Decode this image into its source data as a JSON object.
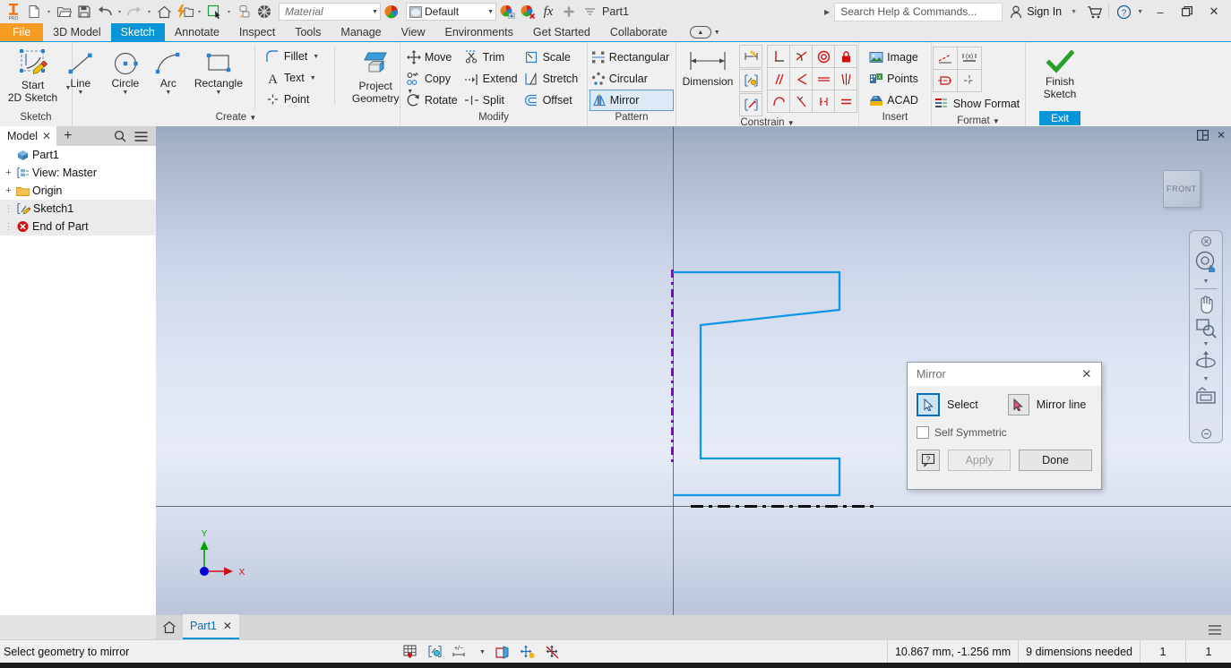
{
  "window": {
    "document_title": "Part1",
    "minimize": "–",
    "restore": "❐",
    "close": "✕"
  },
  "quick_access": {
    "logo": "inventor-pro-logo",
    "items": [
      {
        "name": "new-document",
        "icon": "new-file-icon",
        "has_dropdown": true
      },
      {
        "name": "open-document",
        "icon": "open-folder-icon",
        "has_dropdown": false
      },
      {
        "name": "save-document",
        "icon": "save-disk-icon",
        "has_dropdown": false
      },
      {
        "name": "undo",
        "icon": "undo-arrow-icon",
        "has_dropdown": true
      },
      {
        "name": "redo",
        "icon": "redo-arrow-icon",
        "has_dropdown": true
      },
      {
        "name": "home",
        "icon": "home-icon",
        "has_dropdown": false
      },
      {
        "name": "update",
        "icon": "lightning-update-icon",
        "has_dropdown": true
      },
      {
        "name": "select",
        "icon": "select-cursor-icon",
        "has_dropdown": true
      },
      {
        "name": "return",
        "icon": "return-icon",
        "has_dropdown": false
      },
      {
        "name": "appearance-sphere",
        "icon": "checkered-sphere-icon",
        "has_dropdown": false
      }
    ],
    "material_value": "Material",
    "appearance_value": "Default",
    "extra_icons": [
      {
        "name": "adjust-appearance",
        "icon": "color-wheel-plus-icon"
      },
      {
        "name": "clear-appearance",
        "icon": "color-wheel-x-icon"
      },
      {
        "name": "parameters",
        "icon": "fx-icon"
      },
      {
        "name": "add-to-qat",
        "icon": "plus-icon"
      },
      {
        "name": "customize-qat",
        "icon": "chevron-down-icon"
      }
    ]
  },
  "search": {
    "placeholder": "Search Help & Commands...",
    "value": "Search Help & Commands..."
  },
  "account": {
    "sign_in_label": "Sign In",
    "cart_icon": "shopping-cart-icon",
    "help_icon": "question-circle-icon"
  },
  "menu_tabs": [
    {
      "label": "File",
      "state": "file"
    },
    {
      "label": "3D Model",
      "state": "normal"
    },
    {
      "label": "Sketch",
      "state": "active"
    },
    {
      "label": "Annotate",
      "state": "normal"
    },
    {
      "label": "Inspect",
      "state": "normal"
    },
    {
      "label": "Tools",
      "state": "normal"
    },
    {
      "label": "Manage",
      "state": "normal"
    },
    {
      "label": "View",
      "state": "normal"
    },
    {
      "label": "Environments",
      "state": "normal"
    },
    {
      "label": "Get Started",
      "state": "normal"
    },
    {
      "label": "Collaborate",
      "state": "normal"
    }
  ],
  "ribbon": {
    "groups": [
      {
        "name": "sketch",
        "label": "Sketch",
        "big_buttons": [
          {
            "label_line1": "Start",
            "label_line2": "2D Sketch",
            "icon": "start-2d-sketch-icon",
            "split": true
          }
        ]
      },
      {
        "name": "create",
        "label": "Create",
        "has_dialog_launcher": true,
        "big_buttons": [
          {
            "label_line1": "Line",
            "icon": "line-icon",
            "split": true
          },
          {
            "label_line1": "Circle",
            "icon": "circle-icon",
            "split": true
          },
          {
            "label_line1": "Arc",
            "icon": "arc-icon",
            "split": true
          },
          {
            "label_line1": "Rectangle",
            "icon": "rectangle-icon",
            "split": true
          }
        ],
        "small_items": [
          {
            "label": "Fillet",
            "icon": "fillet-icon",
            "dropdown": true
          },
          {
            "label": "Text",
            "icon": "text-a-icon",
            "dropdown": true
          },
          {
            "label": "Point",
            "icon": "point-icon",
            "dropdown": false
          }
        ],
        "project_button": {
          "label_line1": "Project",
          "label_line2": "Geometry",
          "icon": "project-geometry-icon",
          "split": true
        }
      },
      {
        "name": "modify",
        "label": "Modify",
        "items": [
          {
            "label": "Move",
            "icon": "move-icon"
          },
          {
            "label": "Trim",
            "icon": "trim-scissors-icon"
          },
          {
            "label": "Scale",
            "icon": "scale-icon"
          },
          {
            "label": "Copy",
            "icon": "copy-icon"
          },
          {
            "label": "Extend",
            "icon": "extend-icon"
          },
          {
            "label": "Stretch",
            "icon": "stretch-icon"
          },
          {
            "label": "Rotate",
            "icon": "rotate-icon"
          },
          {
            "label": "Split",
            "icon": "split-icon"
          },
          {
            "label": "Offset",
            "icon": "offset-icon"
          }
        ]
      },
      {
        "name": "pattern",
        "label": "Pattern",
        "items": [
          {
            "label": "Rectangular",
            "icon": "rectangular-pattern-icon",
            "active": false
          },
          {
            "label": "Circular",
            "icon": "circular-pattern-icon",
            "active": false
          },
          {
            "label": "Mirror",
            "icon": "mirror-icon",
            "active": true
          }
        ]
      },
      {
        "name": "constrain",
        "label": "Constrain",
        "has_dialog_launcher": true,
        "dimension_button": {
          "label": "Dimension",
          "icon": "dimension-icon"
        },
        "left_icons": [
          {
            "name": "auto-dimension-icon"
          },
          {
            "name": "show-constraints-icon"
          },
          {
            "name": "constraint-settings-icon"
          }
        ],
        "grid_icons": [
          {
            "name": "perpendicular-constraint-icon"
          },
          {
            "name": "tangent-constraint-icon"
          },
          {
            "name": "concentric-constraint-icon"
          },
          {
            "name": "fix-constraint-icon"
          },
          {
            "name": "parallel-constraint-icon"
          },
          {
            "name": "coincident-constraint-icon"
          },
          {
            "name": "collinear-constraint-icon"
          },
          {
            "name": "symmetric-constraint-icon"
          },
          {
            "name": "smooth-constraint-icon"
          },
          {
            "name": "vertical-constraint-icon"
          },
          {
            "name": "horizontal-constraint-icon"
          },
          {
            "name": "equal-constraint-icon"
          }
        ]
      },
      {
        "name": "insert",
        "label": "Insert",
        "items": [
          {
            "label": "Image",
            "icon": "image-icon"
          },
          {
            "label": "Points",
            "icon": "points-import-icon"
          },
          {
            "label": "ACAD",
            "icon": "acad-import-icon"
          }
        ]
      },
      {
        "name": "format",
        "label": "Format",
        "grid_icons": [
          {
            "name": "construction-line-icon"
          },
          {
            "name": "driven-dimension-icon"
          },
          {
            "name": "centerline-icon"
          },
          {
            "name": "center-point-icon"
          }
        ],
        "show_format": {
          "label": "Show Format",
          "icon": "show-format-icon"
        }
      },
      {
        "name": "exit",
        "label": "Exit",
        "finish_button": {
          "label_line1": "Finish",
          "label_line2": "Sketch",
          "icon": "green-check-icon"
        },
        "exit_label": "Exit"
      }
    ]
  },
  "browser": {
    "tab_label": "Model",
    "close_icon": "close-icon",
    "add_icon": "plus-icon",
    "search_icon": "search-icon",
    "menu_icon": "hamburger-menu-icon",
    "tree": [
      {
        "label": "Part1",
        "icon": "part-cube-icon",
        "depth": 0,
        "expander": "",
        "selected": false
      },
      {
        "label": "View: Master",
        "icon": "view-master-icon",
        "depth": 0,
        "expander": "+",
        "selected": false
      },
      {
        "label": "Origin",
        "icon": "folder-icon",
        "depth": 0,
        "expander": "+",
        "selected": false
      },
      {
        "label": "Sketch1",
        "icon": "sketch-icon",
        "depth": 1,
        "expander": "",
        "selected": true
      },
      {
        "label": "End of Part",
        "icon": "end-of-part-icon",
        "depth": 1,
        "expander": "",
        "selected": true
      }
    ]
  },
  "viewport": {
    "panel_icons": [
      {
        "name": "split-view-icon"
      },
      {
        "name": "close-view-icon"
      }
    ],
    "view_cube_label": "FRONT",
    "nav_bar": [
      {
        "name": "navbar-close-icon"
      },
      {
        "name": "steering-wheel-home-icon"
      },
      {
        "name": "navbar-dropdown-1"
      },
      {
        "name": "pan-hand-icon"
      },
      {
        "name": "zoom-window-icon"
      },
      {
        "name": "navbar-dropdown-2"
      },
      {
        "name": "orbit-icon"
      },
      {
        "name": "navbar-dropdown-3"
      },
      {
        "name": "look-at-icon"
      },
      {
        "name": "navbar-minimize-icon"
      }
    ],
    "axis_labels": {
      "x": "X",
      "y": "Y"
    }
  },
  "mirror_dialog": {
    "title": "Mirror",
    "close_icon": "close-icon",
    "select_button": {
      "label": "Select",
      "icon": "select-arrow-icon",
      "active": true
    },
    "mirror_line_button": {
      "label": "Mirror line",
      "icon": "mirror-line-arrow-icon",
      "active": false
    },
    "self_symmetric": {
      "label": "Self Symmetric",
      "checked": false
    },
    "help_button": {
      "label": "?",
      "icon": "help-icon"
    },
    "apply_button": {
      "label": "Apply",
      "enabled": false
    },
    "done_button": {
      "label": "Done",
      "enabled": true
    }
  },
  "document_tabs": {
    "home_icon": "home-icon",
    "tabs": [
      {
        "label": "Part1",
        "close_icon": "close-icon",
        "active": true
      }
    ],
    "right_menu_icon": "hamburger-menu-icon"
  },
  "status_bar": {
    "message": "Select geometry to mirror",
    "tool_icons": [
      {
        "name": "grid-snap-icon"
      },
      {
        "name": "constraint-display-icon"
      },
      {
        "name": "dimension-display-icon"
      },
      {
        "name": "slice-graphics-icon"
      },
      {
        "name": "dof-display-icon"
      },
      {
        "name": "relax-mode-icon"
      }
    ],
    "coordinates": "10.867 mm, -1.256 mm",
    "dimensions_needed": "9 dimensions needed",
    "count1": "1",
    "count2": "1"
  },
  "colors": {
    "accent_blue": "#0696d7",
    "file_orange": "#f59a23",
    "sketch_line": "#0f96e6",
    "centerline_purple": "#8800cc",
    "axis_x": "#d01010",
    "axis_y": "#00a000",
    "origin_point": "#0000d0"
  }
}
